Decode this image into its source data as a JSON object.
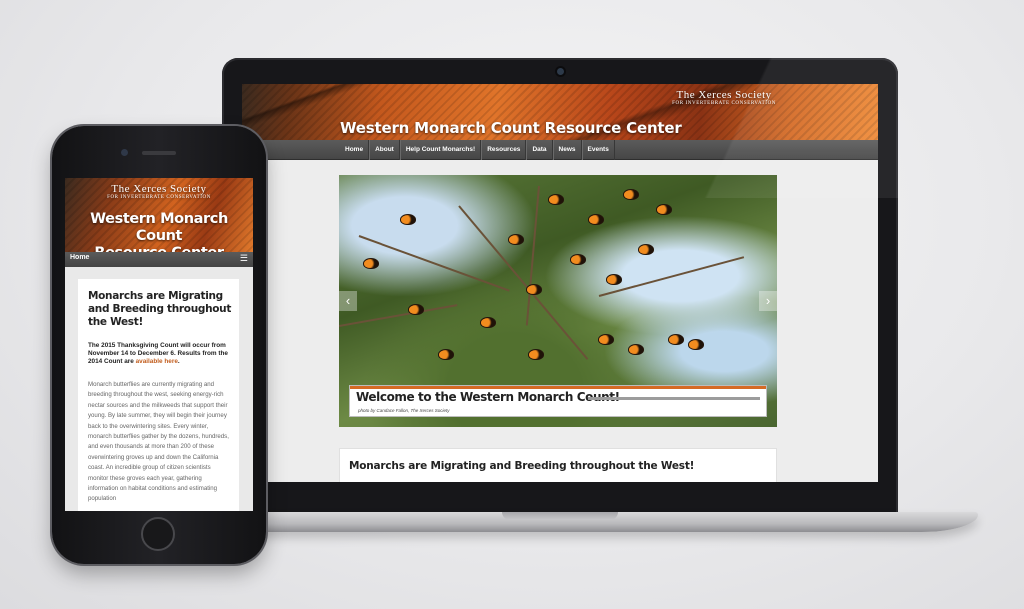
{
  "site": {
    "title": "Western Monarch Count Resource Center",
    "logo_line1": "The Xerces Society",
    "logo_line2": "For Invertebrate Conservation"
  },
  "nav": {
    "items": [
      "Home",
      "About",
      "Help Count Monarchs!",
      "Resources",
      "Data",
      "News",
      "Events"
    ]
  },
  "slider": {
    "caption_title": "Welcome to the Western Monarch Count!",
    "caption_credit": "photo by Candace Fallon, The Xerces Society",
    "prev_icon": "‹",
    "next_icon": "›"
  },
  "article": {
    "title": "Monarchs are Migrating and Breeding throughout the West!"
  },
  "mobile": {
    "logo_line1": "The Xerces Society",
    "logo_line2": "For Invertebrate Conservation",
    "title_line1": "Western Monarch Count",
    "title_line2": "Resource Center",
    "nav_home": "Home",
    "menu_icon": "☰",
    "heading": "Monarchs are Migrating and Breeding throughout the West!",
    "notice_text": "The 2015 Thanksgiving Count will occur from November 14 to December 6. Results from the 2014 Count are ",
    "notice_link": "available here",
    "notice_end": ".",
    "body": "Monarch butterflies are currently migrating and breeding throughout the west, seeking energy-rich nectar sources and the milkweeds that support their young. By late summer, they will begin their journey back to the overwintering sites. Every winter, monarch butterflies gather by the dozens, hundreds, and even thousands at more than 200 of these overwintering groves up and down the California coast. An incredible group of citizen scientists monitor these groves each year, gathering information on habitat conditions and estimating population"
  }
}
